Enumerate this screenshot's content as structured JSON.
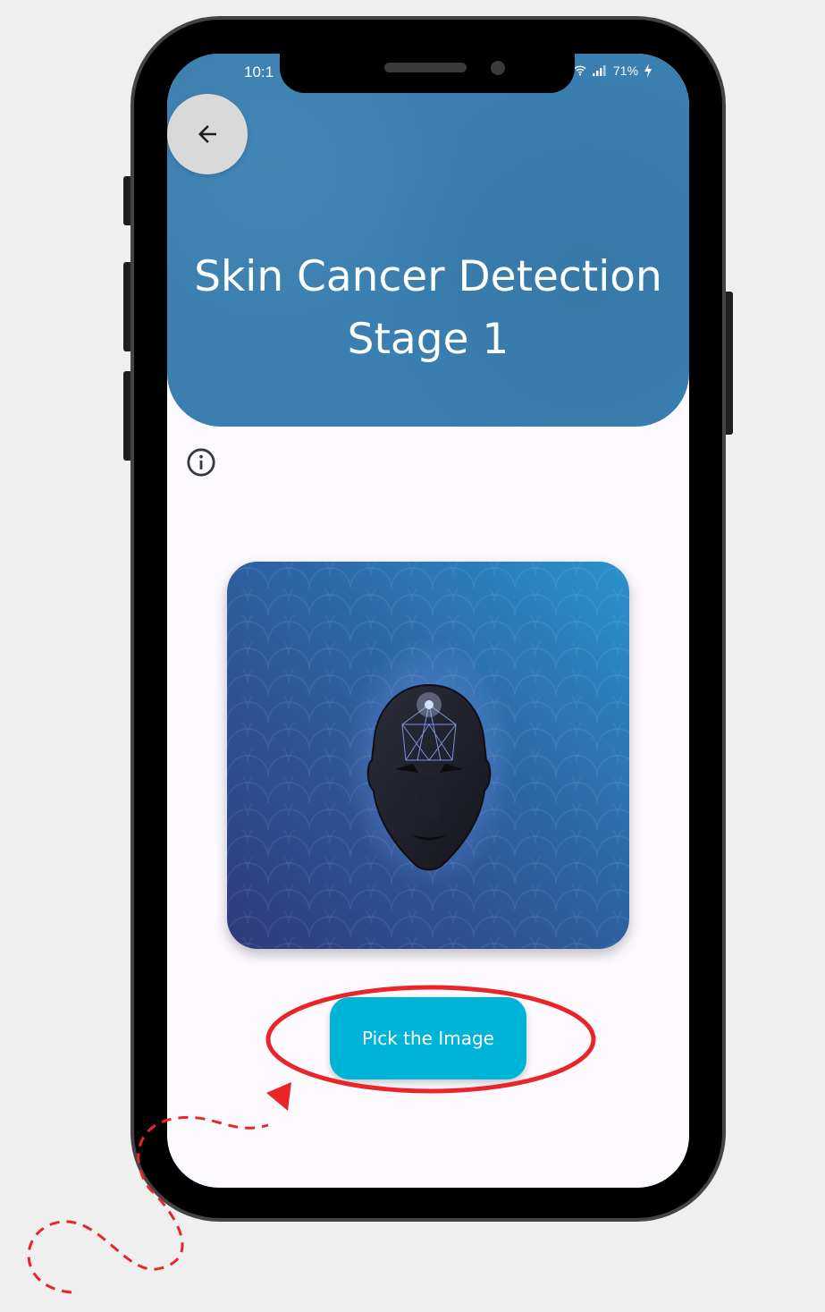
{
  "status_bar": {
    "time": "10:1",
    "battery": "71%",
    "icons": [
      "wifi-icon",
      "signal-icon",
      "battery-charging-icon"
    ]
  },
  "header": {
    "title_line1": "Skin Cancer Detection",
    "title_line2": "Stage 1",
    "back_icon": "arrow-left-icon",
    "color": "#3a7fb0"
  },
  "info_icon": "info-circle-icon",
  "hero": {
    "icon": "face-scan-illustration"
  },
  "action": {
    "pick_label": "Pick the Image",
    "color": "#00b4d8"
  },
  "annotation": {
    "highlight_color": "#e8262a"
  }
}
